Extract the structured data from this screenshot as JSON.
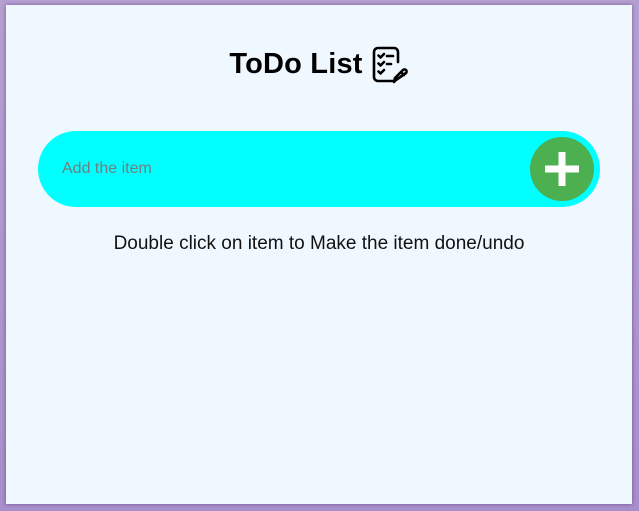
{
  "header": {
    "title": "ToDo List",
    "icon": "checklist-edit-icon"
  },
  "input": {
    "placeholder": "Add the item",
    "value": ""
  },
  "add_button": {
    "icon": "plus-icon",
    "color": "#4caf50"
  },
  "hint": "Double click on item to Make the item done/undo",
  "colors": {
    "page_background": "#f0f8ff",
    "input_background": "#00ffff",
    "frame_background": "#b6a0d2"
  }
}
